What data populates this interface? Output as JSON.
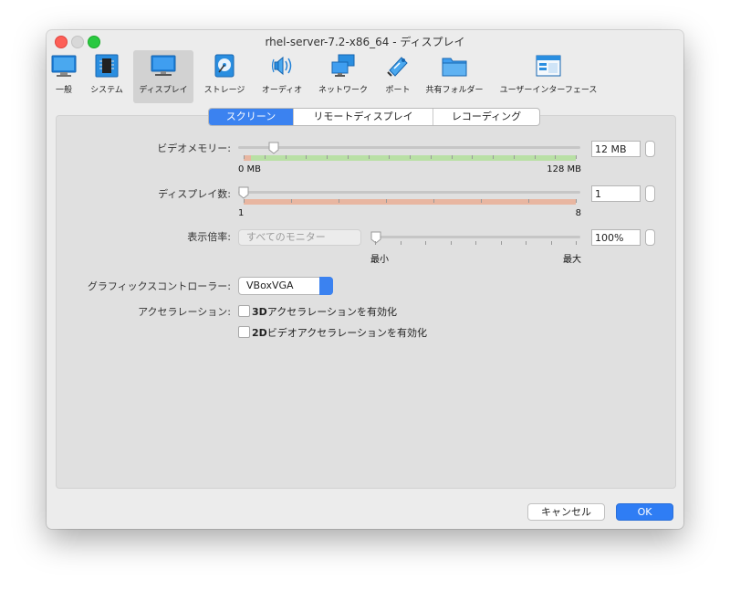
{
  "window": {
    "title": "rhel-server-7.2-x86_64 - ディスプレイ"
  },
  "toolbar": {
    "items": [
      {
        "label": "一般",
        "icon": "monitor-general-icon"
      },
      {
        "label": "システム",
        "icon": "chip-icon"
      },
      {
        "label": "ディスプレイ",
        "icon": "display-icon",
        "selected": true
      },
      {
        "label": "ストレージ",
        "icon": "disk-icon"
      },
      {
        "label": "オーディオ",
        "icon": "speaker-icon"
      },
      {
        "label": "ネットワーク",
        "icon": "network-icon"
      },
      {
        "label": "ポート",
        "icon": "port-icon"
      },
      {
        "label": "共有フォルダー",
        "icon": "folder-icon"
      },
      {
        "label": "ユーザーインターフェース",
        "icon": "ui-window-icon"
      }
    ]
  },
  "tabs": [
    {
      "label": "スクリーン",
      "active": true
    },
    {
      "label": "リモートディスプレイ",
      "active": false
    },
    {
      "label": "レコーディング",
      "active": false
    }
  ],
  "screen": {
    "video_memory": {
      "label": "ビデオメモリー:",
      "value": "12 MB",
      "min": "0 MB",
      "max": "128 MB",
      "level": 0.094
    },
    "monitor_count": {
      "label": "ディスプレイ数:",
      "value": "1",
      "min": "1",
      "max": "8",
      "level": 0
    },
    "scale_factor": {
      "label": "表示倍率:",
      "monitor_combo": "すべてのモニター",
      "value": "100%",
      "min": "最小",
      "max": "最大",
      "level": 0
    },
    "graphics_controller": {
      "label": "グラフィックスコントローラー:",
      "value": "VBoxVGA"
    },
    "acceleration": {
      "label": "アクセラレーション:",
      "accel_3d_prefix": "3D",
      "accel_3d_text": "アクセラレーションを有効化",
      "accel_2d_prefix": "2D",
      "accel_2d_text": "ビデオアクセラレーションを有効化"
    }
  },
  "buttons": {
    "cancel": "キャンセル",
    "ok": "OK"
  },
  "colors": {
    "accent": "#3b82f0",
    "range_ok": "#b9e0a5",
    "range_warn": "#e8b6a1"
  }
}
